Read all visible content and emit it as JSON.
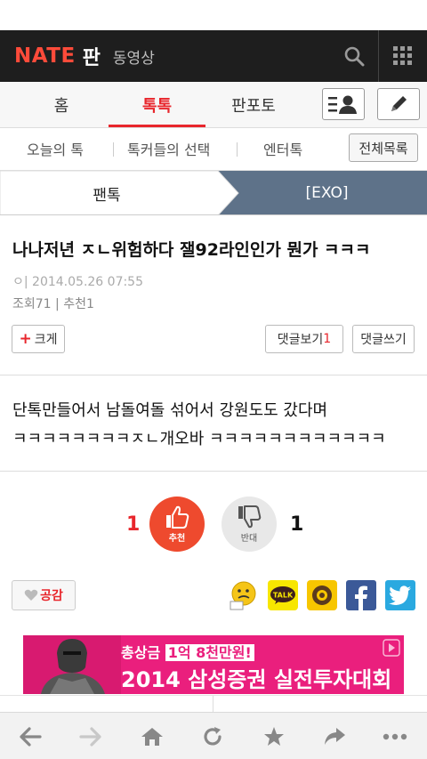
{
  "header": {
    "logo_main": "NATE",
    "logo_sub": "판",
    "video_link": "동영상"
  },
  "tabs": [
    {
      "label": "홈"
    },
    {
      "label": "톡톡"
    },
    {
      "label": "판포토"
    }
  ],
  "subnav": {
    "items": [
      "오늘의 톡",
      "톡커들의 선택",
      "엔터톡"
    ],
    "all_button": "전체목록"
  },
  "breadcrumb": {
    "left": "팬톡",
    "right": "[EXO]"
  },
  "article": {
    "title": "나나저년 ㅈㄴ위험하다 잴92라인인가 뭔가 ㅋㅋㅋ",
    "author_date": "ㅇ| 2014.05.26 07:55",
    "stats": "조회71 | 추천1",
    "enlarge_button": "크게",
    "view_comments_label": "댓글보기",
    "view_comments_count": "1",
    "write_comment_button": "댓글쓰기",
    "body_line1": "단톡만들어서 남돌여돌 섞어서 강원도도 갔다며",
    "body_line2": "ㅋㅋㅋㅋㅋㅋㅋㅋㅈㄴ개오바 ㅋㅋㅋㅋㅋㅋㅋㅋㅋㅋㅋㅋ"
  },
  "votes": {
    "recommend_count": "1",
    "recommend_label": "추천",
    "oppose_count": "1",
    "oppose_label": "반대"
  },
  "empathy_button": "공감",
  "share_icons": [
    "emoticon-icon",
    "kakaotalk-icon",
    "kakaostory-icon",
    "facebook-icon",
    "twitter-icon"
  ],
  "ad": {
    "line1_prefix": "총상금",
    "line1_highlight": "1억 8천만원!",
    "line2": "2014 삼성증권 실전투자대회"
  },
  "colors": {
    "accent": "#e8262c",
    "header_bg": "#1e1e1e",
    "breadcrumb_active": "#5e7289",
    "ad_bg": "#ea1f7d"
  }
}
